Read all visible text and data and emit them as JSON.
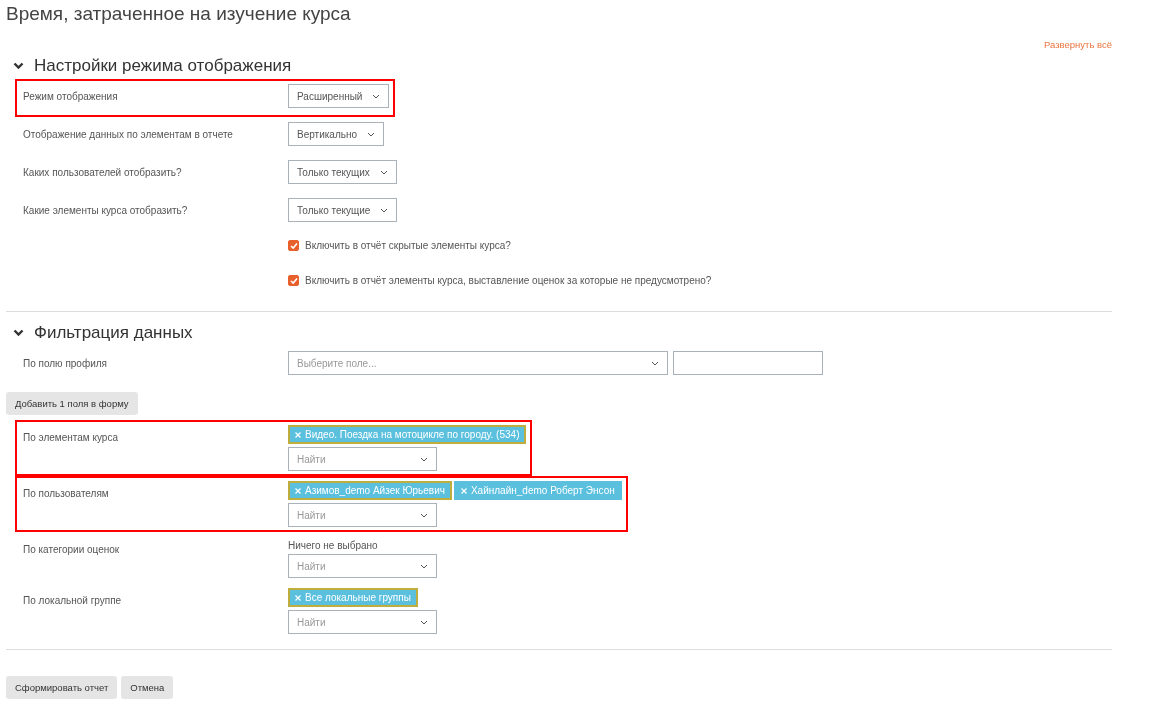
{
  "page_title": "Время, затраченное на изучение курса",
  "expand_all_link": "Развернуть всё",
  "sections": [
    {
      "title": "Настройки режима отображения",
      "expanded": true,
      "fields": [
        {
          "kind": "select",
          "label": "Режим отображения",
          "value": "Расширенный",
          "highlighted": true
        },
        {
          "kind": "select",
          "label": "Отображение данных по элементам в отчете",
          "value": "Вертикально",
          "highlighted": false
        },
        {
          "kind": "select",
          "label": "Каких пользователей отобразить?",
          "value": "Только текущих",
          "highlighted": false
        },
        {
          "kind": "select",
          "label": "Какие элементы курса отобразить?",
          "value": "Только текущие",
          "highlighted": false
        },
        {
          "kind": "checkbox",
          "label": "Включить в отчёт скрытые элементы курса?",
          "checked": true,
          "highlighted": false
        },
        {
          "kind": "checkbox",
          "label": "Включить в отчёт элементы курса, выставление оценок за которые не предусмотрено?",
          "checked": true,
          "highlighted": false
        }
      ]
    },
    {
      "title": "Фильтрация данных",
      "expanded": true,
      "fields": [
        {
          "kind": "profile",
          "label": "По полю профиля",
          "placeholder": "Выберите поле...",
          "highlighted": false
        },
        {
          "kind": "button",
          "label": "Добавить 1 поля в форму"
        },
        {
          "kind": "autocomplete",
          "label": "По элементам курса",
          "chips": [
            {
              "text": "Видео. Поездка на мотоцикле по городу. (534)",
              "focused": true
            }
          ],
          "placeholder": "Найти",
          "highlighted": true
        },
        {
          "kind": "autocomplete",
          "label": "По пользователям",
          "chips": [
            {
              "text": "Азимов_demo Айзек Юрьевич",
              "focused": true
            },
            {
              "text": "Хайнлайн_demo Роберт Энсон",
              "focused": false
            }
          ],
          "placeholder": "Найти",
          "highlighted": true
        },
        {
          "kind": "autocomplete",
          "label": "По категории оценок",
          "empty_text": "Ничего не выбрано",
          "placeholder": "Найти",
          "highlighted": false
        },
        {
          "kind": "autocomplete",
          "label": "По локальной группе",
          "chips": [
            {
              "text": "Все локальные группы",
              "focused": true
            }
          ],
          "placeholder": "Найти",
          "highlighted": false
        }
      ]
    }
  ],
  "buttons": [
    "Сформировать отчет",
    "Отмена"
  ]
}
